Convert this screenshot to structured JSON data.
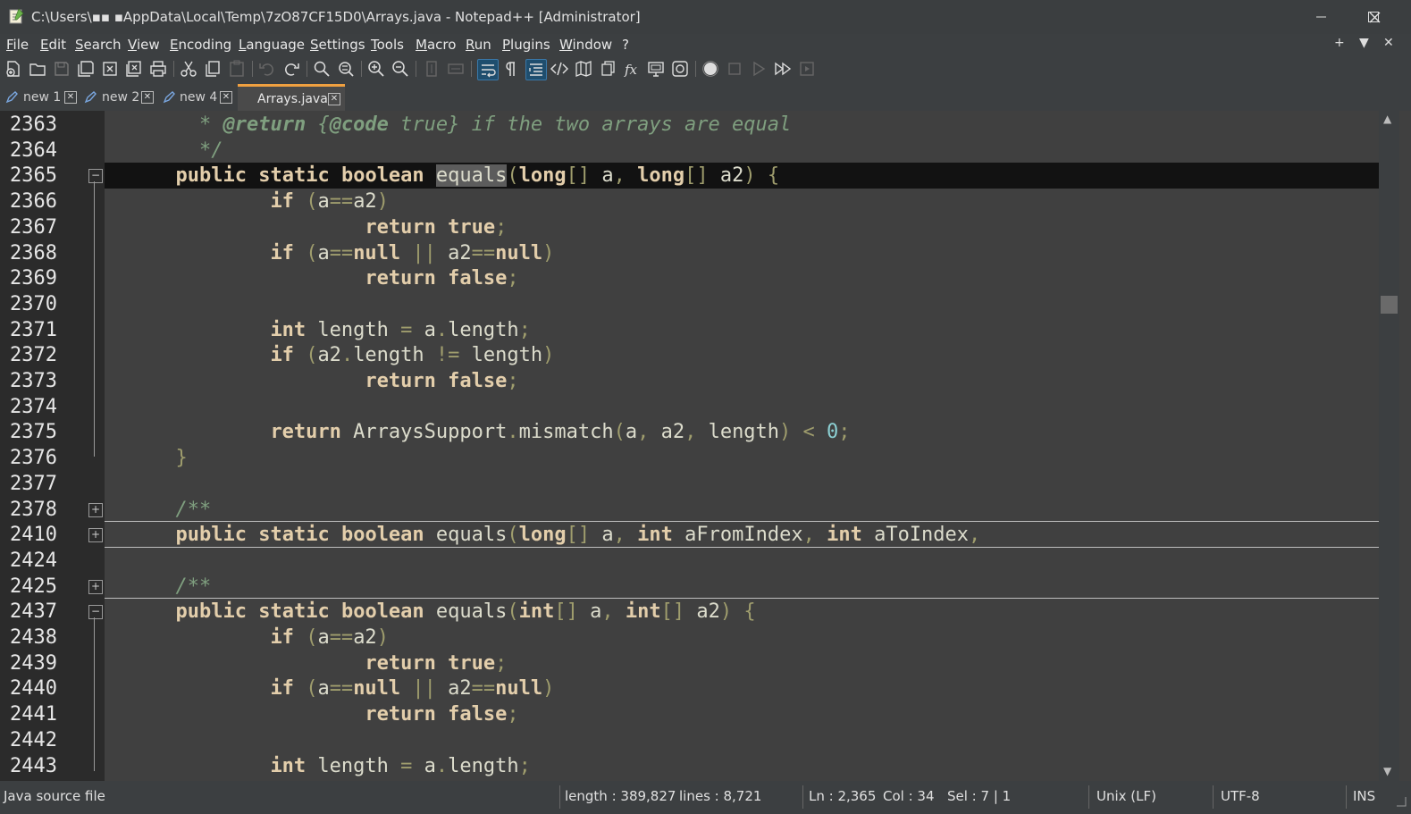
{
  "window": {
    "title": "C:\\Users\\▪▪ ▪AppData\\Local\\Temp\\7zO87CF15D0\\Arrays.java - Notepad++ [Administrator]",
    "minimize": "—",
    "maximize": "☐",
    "close": "✕"
  },
  "menu": {
    "items": [
      "File",
      "Edit",
      "Search",
      "View",
      "Encoding",
      "Language",
      "Settings",
      "Tools",
      "Macro",
      "Run",
      "Plugins",
      "Window",
      "?"
    ],
    "right": [
      "+",
      "▼",
      "✕"
    ]
  },
  "toolbar": {
    "icons": [
      "new-file-icon",
      "open-file-icon",
      "save-icon",
      "save-all-icon",
      "close-icon",
      "close-all-icon",
      "print-icon",
      "cut-icon",
      "copy-icon",
      "paste-icon",
      "undo-icon",
      "redo-icon",
      "find-icon",
      "replace-icon",
      "zoom-in-icon",
      "zoom-out-icon",
      "sync-vertical-icon",
      "sync-horizontal-icon",
      "word-wrap-icon",
      "show-all-chars-icon",
      "indent-guide-icon",
      "xml-tag-icon",
      "document-map-icon",
      "document-list-icon",
      "function-list-icon",
      "folder-workspace-icon",
      "monitoring-icon",
      "record-macro-icon",
      "stop-record-icon",
      "playback-macro-icon",
      "run-macro-multiple-icon",
      "save-macro-icon"
    ]
  },
  "tabs": [
    {
      "label": "new 1",
      "active": false
    },
    {
      "label": "new 2",
      "active": false
    },
    {
      "label": "new 4",
      "active": false
    },
    {
      "label": "Arrays.java",
      "active": true
    }
  ],
  "editor": {
    "line_numbers": [
      "2363",
      "2364",
      "2365",
      "2366",
      "2367",
      "2368",
      "2369",
      "2370",
      "2371",
      "2372",
      "2373",
      "2374",
      "2375",
      "2376",
      "2377",
      "2378",
      "2410",
      "2424",
      "2425",
      "2437",
      "2438",
      "2439",
      "2440",
      "2441",
      "2442",
      "2443"
    ],
    "fold_markers": {
      "2365": "−",
      "2378": "+",
      "2410": "+",
      "2425": "+",
      "2437": "−"
    },
    "lines": [
      {
        "no": "2363",
        "indent": "   ",
        "t": [
          [
            "cm",
            "* "
          ],
          [
            "cmk",
            "@return"
          ],
          [
            "cm",
            " {"
          ],
          [
            "cmk",
            "@code"
          ],
          [
            "cm",
            " true} if the two arrays are equal"
          ]
        ]
      },
      {
        "no": "2364",
        "indent": "   ",
        "t": [
          [
            "cm",
            "*/"
          ]
        ]
      },
      {
        "no": "2365",
        "indent": "  ",
        "current": true,
        "t": [
          [
            "kw",
            "public"
          ],
          [
            "",
            "",
            " "
          ],
          [
            "kw",
            "static"
          ],
          [
            "",
            "",
            " "
          ],
          [
            "kw",
            "boolean"
          ],
          [
            "",
            " "
          ],
          [
            "sel",
            "equals"
          ],
          [
            "op",
            "("
          ],
          [
            "kw",
            "long"
          ],
          [
            "op",
            "[]"
          ],
          [
            "",
            " a"
          ],
          [
            "op",
            ","
          ],
          [
            "",
            " "
          ],
          [
            "kw",
            "long"
          ],
          [
            "op",
            "[]"
          ],
          [
            "",
            " a2"
          ],
          [
            "op",
            ")"
          ],
          [
            "",
            " "
          ],
          [
            "op",
            "{"
          ]
        ]
      },
      {
        "no": "2366",
        "indent": "      ",
        "t": [
          [
            "kw",
            "if"
          ],
          [
            "",
            " "
          ],
          [
            "op",
            "("
          ],
          [
            "",
            "a"
          ],
          [
            "op",
            "=="
          ],
          [
            "",
            "a2"
          ],
          [
            "op",
            ")"
          ]
        ]
      },
      {
        "no": "2367",
        "indent": "          ",
        "t": [
          [
            "kw",
            "return"
          ],
          [
            "",
            " "
          ],
          [
            "kw",
            "true"
          ],
          [
            "op",
            ";"
          ]
        ]
      },
      {
        "no": "2368",
        "indent": "      ",
        "t": [
          [
            "kw",
            "if"
          ],
          [
            "",
            " "
          ],
          [
            "op",
            "("
          ],
          [
            "",
            "a"
          ],
          [
            "op",
            "=="
          ],
          [
            "kw",
            "null"
          ],
          [
            "",
            " "
          ],
          [
            "op",
            "||"
          ],
          [
            "",
            " a2"
          ],
          [
            "op",
            "=="
          ],
          [
            "kw",
            "null"
          ],
          [
            "op",
            ")"
          ]
        ]
      },
      {
        "no": "2369",
        "indent": "          ",
        "t": [
          [
            "kw",
            "return"
          ],
          [
            "",
            " "
          ],
          [
            "kw",
            "false"
          ],
          [
            "op",
            ";"
          ]
        ]
      },
      {
        "no": "2370",
        "indent": "",
        "t": []
      },
      {
        "no": "2371",
        "indent": "      ",
        "t": [
          [
            "kw",
            "int"
          ],
          [
            "",
            " length "
          ],
          [
            "op",
            "="
          ],
          [
            "",
            " a"
          ],
          [
            "op",
            "."
          ],
          [
            "",
            "length"
          ],
          [
            "op",
            ";"
          ]
        ]
      },
      {
        "no": "2372",
        "indent": "      ",
        "t": [
          [
            "kw",
            "if"
          ],
          [
            "",
            " "
          ],
          [
            "op",
            "("
          ],
          [
            "",
            "a2"
          ],
          [
            "op",
            "."
          ],
          [
            "",
            "length "
          ],
          [
            "op",
            "!="
          ],
          [
            "",
            " length"
          ],
          [
            "op",
            ")"
          ]
        ]
      },
      {
        "no": "2373",
        "indent": "          ",
        "t": [
          [
            "kw",
            "return"
          ],
          [
            "",
            " "
          ],
          [
            "kw",
            "false"
          ],
          [
            "op",
            ";"
          ]
        ]
      },
      {
        "no": "2374",
        "indent": "",
        "t": []
      },
      {
        "no": "2375",
        "indent": "      ",
        "t": [
          [
            "kw",
            "return"
          ],
          [
            "",
            " ArraysSupport"
          ],
          [
            "op",
            "."
          ],
          [
            "",
            "mismatch"
          ],
          [
            "op",
            "("
          ],
          [
            "",
            "a"
          ],
          [
            "op",
            ","
          ],
          [
            "",
            " a2"
          ],
          [
            "op",
            ","
          ],
          [
            "",
            " length"
          ],
          [
            "op",
            ")"
          ],
          [
            "",
            " "
          ],
          [
            "op",
            "<"
          ],
          [
            "",
            " "
          ],
          [
            "num",
            "0"
          ],
          [
            "op",
            ";"
          ]
        ]
      },
      {
        "no": "2376",
        "indent": "  ",
        "t": [
          [
            "op",
            "}"
          ]
        ]
      },
      {
        "no": "2377",
        "indent": "",
        "t": []
      },
      {
        "no": "2378",
        "indent": "  ",
        "t": [
          [
            "cm",
            "/**"
          ]
        ]
      },
      {
        "no": "2410",
        "indent": "  ",
        "t": [
          [
            "kw",
            "public"
          ],
          [
            "",
            " "
          ],
          [
            "kw",
            "static"
          ],
          [
            "",
            " "
          ],
          [
            "kw",
            "boolean"
          ],
          [
            "",
            " equals"
          ],
          [
            "op",
            "("
          ],
          [
            "kw",
            "long"
          ],
          [
            "op",
            "[]"
          ],
          [
            "",
            " a"
          ],
          [
            "op",
            ","
          ],
          [
            "",
            " "
          ],
          [
            "kw",
            "int"
          ],
          [
            "",
            " aFromIndex"
          ],
          [
            "op",
            ","
          ],
          [
            "",
            " "
          ],
          [
            "kw",
            "int"
          ],
          [
            "",
            " aToIndex"
          ],
          [
            "op",
            ","
          ]
        ]
      },
      {
        "no": "2424",
        "indent": "",
        "t": []
      },
      {
        "no": "2425",
        "indent": "  ",
        "t": [
          [
            "cm",
            "/**"
          ]
        ]
      },
      {
        "no": "2437",
        "indent": "  ",
        "t": [
          [
            "kw",
            "public"
          ],
          [
            "",
            " "
          ],
          [
            "kw",
            "static"
          ],
          [
            "",
            " "
          ],
          [
            "kw",
            "boolean"
          ],
          [
            "",
            " equals"
          ],
          [
            "op",
            "("
          ],
          [
            "kw",
            "int"
          ],
          [
            "op",
            "[]"
          ],
          [
            "",
            " a"
          ],
          [
            "op",
            ","
          ],
          [
            "",
            " "
          ],
          [
            "kw",
            "int"
          ],
          [
            "op",
            "[]"
          ],
          [
            "",
            " a2"
          ],
          [
            "op",
            ")"
          ],
          [
            "",
            " "
          ],
          [
            "op",
            "{"
          ]
        ]
      },
      {
        "no": "2438",
        "indent": "      ",
        "t": [
          [
            "kw",
            "if"
          ],
          [
            "",
            " "
          ],
          [
            "op",
            "("
          ],
          [
            "",
            "a"
          ],
          [
            "op",
            "=="
          ],
          [
            "",
            "a2"
          ],
          [
            "op",
            ")"
          ]
        ]
      },
      {
        "no": "2439",
        "indent": "          ",
        "t": [
          [
            "kw",
            "return"
          ],
          [
            "",
            " "
          ],
          [
            "kw",
            "true"
          ],
          [
            "op",
            ";"
          ]
        ]
      },
      {
        "no": "2440",
        "indent": "      ",
        "t": [
          [
            "kw",
            "if"
          ],
          [
            "",
            " "
          ],
          [
            "op",
            "("
          ],
          [
            "",
            "a"
          ],
          [
            "op",
            "=="
          ],
          [
            "kw",
            "null"
          ],
          [
            "",
            " "
          ],
          [
            "op",
            "||"
          ],
          [
            "",
            " a2"
          ],
          [
            "op",
            "=="
          ],
          [
            "kw",
            "null"
          ],
          [
            "op",
            ")"
          ]
        ]
      },
      {
        "no": "2441",
        "indent": "          ",
        "t": [
          [
            "kw",
            "return"
          ],
          [
            "",
            " "
          ],
          [
            "kw",
            "false"
          ],
          [
            "op",
            ";"
          ]
        ]
      },
      {
        "no": "2442",
        "indent": "",
        "t": []
      },
      {
        "no": "2443",
        "indent": "      ",
        "t": [
          [
            "kw",
            "int"
          ],
          [
            "",
            " length "
          ],
          [
            "op",
            "="
          ],
          [
            "",
            " a"
          ],
          [
            "op",
            "."
          ],
          [
            "",
            "length"
          ],
          [
            "op",
            ";"
          ]
        ]
      }
    ]
  },
  "status": {
    "file_type": "Java source file",
    "length": "length : 389,827",
    "lines": "lines : 8,721",
    "ln": "Ln : 2,365",
    "col": "Col : 34",
    "sel": "Sel : 7 | 1",
    "eol": "Unix (LF)",
    "encoding": "UTF-8",
    "mode": "INS"
  },
  "colors": {
    "keyword": "#e3ceab",
    "comment": "#7f9f7f",
    "number": "#8cd0d3",
    "operator": "#9f9d6d",
    "text": "#dcdccc",
    "editor_bg": "#404040",
    "current_line_bg": "#121212",
    "active_tab_accent": "#f0a040"
  }
}
